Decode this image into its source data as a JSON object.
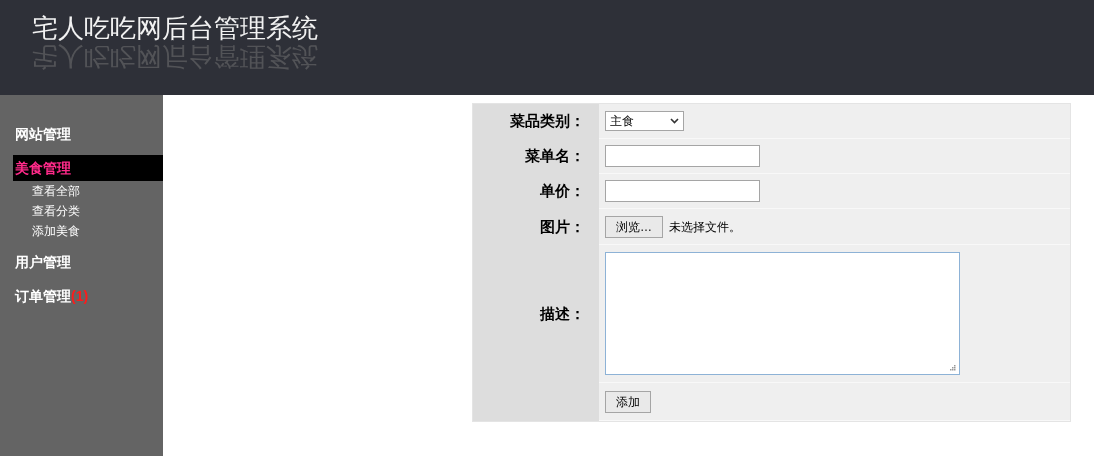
{
  "header": {
    "title": "宅人吃吃网后台管理系统",
    "title_reflection": "宅人吃吃网后台管理系统"
  },
  "sidebar": {
    "items": [
      {
        "label": "网站管理",
        "selected": false
      },
      {
        "label": "美食管理",
        "selected": true,
        "children": [
          {
            "label": "查看全部"
          },
          {
            "label": "查看分类"
          },
          {
            "label": "添加美食"
          }
        ]
      },
      {
        "label": "用户管理",
        "selected": false
      },
      {
        "label": "订单管理",
        "selected": false,
        "badge": "(1)"
      }
    ]
  },
  "form": {
    "rows": [
      {
        "kind": "select",
        "label": "菜品类别：",
        "value": "主食"
      },
      {
        "kind": "text",
        "label": "菜单名："
      },
      {
        "kind": "text",
        "label": "单价："
      },
      {
        "kind": "file",
        "label": "图片：",
        "button": "浏览…",
        "status": "未选择文件。"
      },
      {
        "kind": "textarea",
        "label": "描述："
      },
      {
        "kind": "submit",
        "button": "添加"
      }
    ]
  }
}
